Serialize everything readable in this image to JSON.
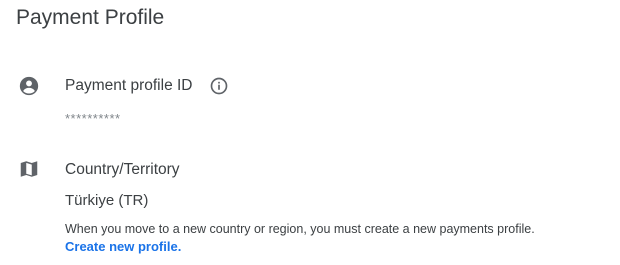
{
  "page": {
    "title": "Payment Profile"
  },
  "payment_profile": {
    "label": "Payment profile ID",
    "label_icon": "account-circle-icon",
    "info_icon": "info-icon",
    "masked_value": "**********"
  },
  "country": {
    "label": "Country/Territory",
    "label_icon": "map-icon",
    "value": "Türkiye (TR)",
    "note": "When you move to a new country or region, you must create a new payments profile.",
    "link_label": "Create new profile."
  },
  "colors": {
    "text": "#3c4043",
    "muted": "#80868b",
    "icon": "#5f6368",
    "link": "#1a73e8"
  }
}
